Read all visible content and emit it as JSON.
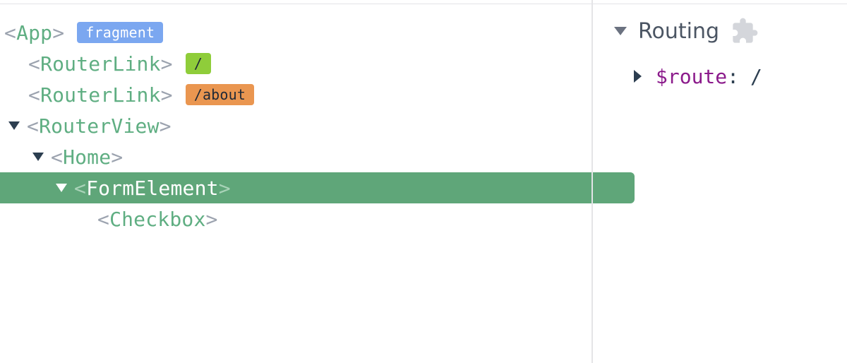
{
  "component_tree": {
    "app": {
      "open": "<",
      "name": "App",
      "close": ">",
      "badge": "fragment"
    },
    "router_link_1": {
      "open": "<",
      "name": "RouterLink",
      "close": ">",
      "badge": "/"
    },
    "router_link_2": {
      "open": "<",
      "name": "RouterLink",
      "close": ">",
      "badge": "/about"
    },
    "router_view": {
      "open": "<",
      "name": "RouterView",
      "close": ">"
    },
    "home": {
      "open": "<",
      "name": "Home",
      "close": ">"
    },
    "form_element": {
      "open": "<",
      "name": "FormElement",
      "close": ">",
      "selected": true
    },
    "checkbox": {
      "open": "<",
      "name": "Checkbox",
      "close": ">"
    }
  },
  "inspector": {
    "section_title": "Routing",
    "section_icon": "puzzle-icon",
    "property": {
      "key": "$route",
      "colon": ":",
      "value": "/"
    }
  },
  "colors": {
    "selected_row": "#5fa679",
    "component_name": "#5fae82",
    "badge_fragment": "#7ba7f0",
    "badge_root": "#8fcd3a",
    "badge_about": "#ea9650",
    "property_key": "#8b1a8b"
  }
}
